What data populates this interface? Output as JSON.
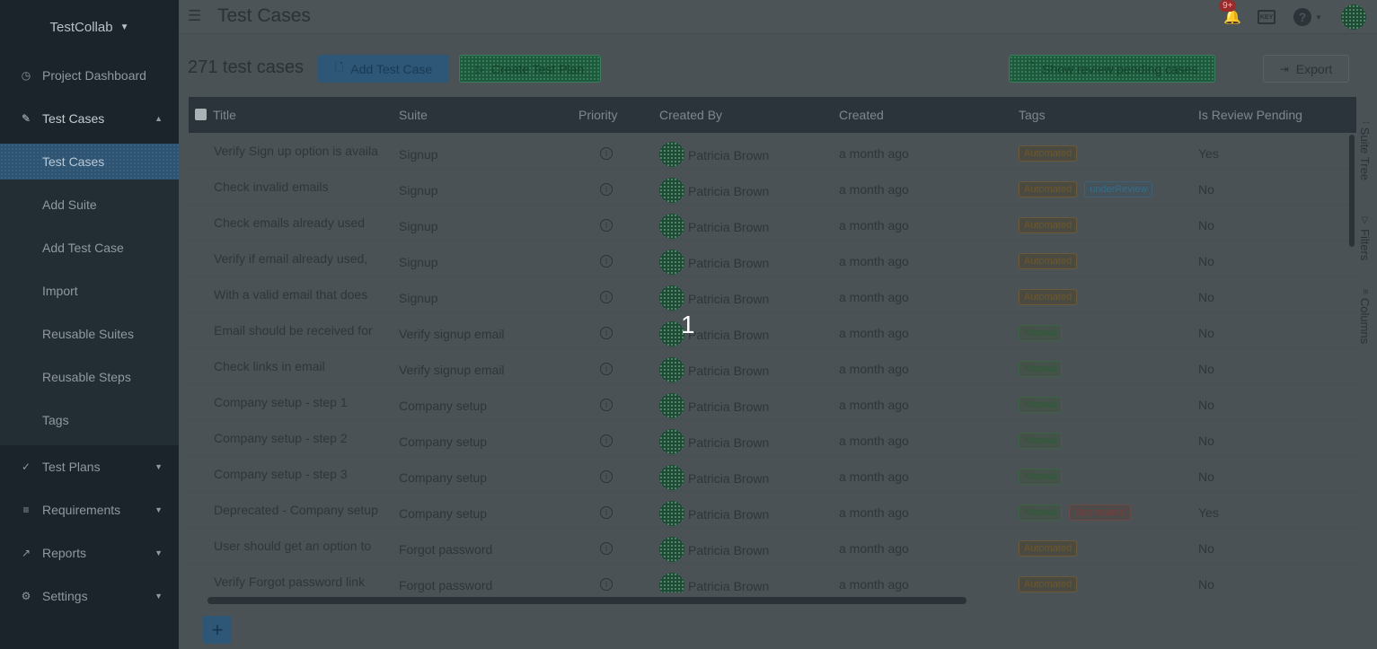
{
  "sidebar": {
    "brand": "TestCollab",
    "items": [
      {
        "label": "Project Dashboard",
        "icon": "clock-icon"
      },
      {
        "label": "Test Cases",
        "icon": "edit-icon"
      },
      {
        "label": "Test Plans",
        "icon": "check-circle-icon"
      },
      {
        "label": "Requirements",
        "icon": "list-icon"
      },
      {
        "label": "Reports",
        "icon": "chart-icon"
      },
      {
        "label": "Settings",
        "icon": "gear-icon"
      }
    ],
    "sub_items": [
      "Test Cases",
      "Add Suite",
      "Add Test Case",
      "Import",
      "Reusable Suites",
      "Reusable Steps",
      "Tags"
    ]
  },
  "header": {
    "title": "Test Cases",
    "notification_count": "9+",
    "keyboard_icon_text": "KEY"
  },
  "toolbar": {
    "count_text": "271 test cases",
    "add_label": "Add Test Case",
    "plan_label": "Create Test Plan",
    "review_label": "Show review pending cases",
    "export_label": "Export"
  },
  "table": {
    "columns": [
      "Title",
      "Suite",
      "Priority",
      "Created By",
      "Created",
      "Tags",
      "Is Review Pending"
    ],
    "rows": [
      {
        "title": "Verify Sign up option is available",
        "suite": "Signup",
        "created_by": "Patricia Brown",
        "created": "a month ago",
        "tags": [
          {
            "label": "Automated",
            "kind": "automated"
          }
        ],
        "pending": "Yes"
      },
      {
        "title": "Check invalid emails",
        "suite": "Signup",
        "created_by": "Patricia Brown",
        "created": "a month ago",
        "tags": [
          {
            "label": "Automated",
            "kind": "automated"
          },
          {
            "label": "underReview",
            "kind": "review"
          }
        ],
        "pending": "No"
      },
      {
        "title": "Check emails already used",
        "suite": "Signup",
        "created_by": "Patricia Brown",
        "created": "a month ago",
        "tags": [
          {
            "label": "Automated",
            "kind": "automated"
          }
        ],
        "pending": "No"
      },
      {
        "title": "Verify if email already used, ",
        "suite": "Signup",
        "created_by": "Patricia Brown",
        "created": "a month ago",
        "tags": [
          {
            "label": "Automated",
            "kind": "automated"
          }
        ],
        "pending": "No"
      },
      {
        "title": "With a valid email that does",
        "suite": "Signup",
        "created_by": "Patricia Brown",
        "created": "a month ago",
        "tags": [
          {
            "label": "Automated",
            "kind": "automated"
          }
        ],
        "pending": "No"
      },
      {
        "title": "Email should be received for",
        "suite": "Verify signup email",
        "created_by": "Patricia Brown",
        "created": "a month ago",
        "tags": [
          {
            "label": "Manual",
            "kind": "manual"
          }
        ],
        "pending": "No"
      },
      {
        "title": "Check links in email",
        "suite": "Verify signup email",
        "created_by": "Patricia Brown",
        "created": "a month ago",
        "tags": [
          {
            "label": "Manual",
            "kind": "manual"
          }
        ],
        "pending": "No"
      },
      {
        "title": "Company setup - step 1",
        "suite": "Company setup",
        "created_by": "Patricia Brown",
        "created": "a month ago",
        "tags": [
          {
            "label": "Manual",
            "kind": "manual"
          }
        ],
        "pending": "No"
      },
      {
        "title": "Company setup - step 2",
        "suite": "Company setup",
        "created_by": "Patricia Brown",
        "created": "a month ago",
        "tags": [
          {
            "label": "Manual",
            "kind": "manual"
          }
        ],
        "pending": "No"
      },
      {
        "title": "Company setup - step 3",
        "suite": "Company setup",
        "created_by": "Patricia Brown",
        "created": "a month ago",
        "tags": [
          {
            "label": "Manual",
            "kind": "manual"
          }
        ],
        "pending": "No"
      },
      {
        "title": "Deprecated - Company setup",
        "suite": "Company setup",
        "created_by": "Patricia Brown",
        "created": "a month ago",
        "tags": [
          {
            "label": "Manual",
            "kind": "manual"
          },
          {
            "label": "Deprecated",
            "kind": "deprecated"
          }
        ],
        "pending": "Yes"
      },
      {
        "title": "User should get an option to",
        "suite": "Forgot password",
        "created_by": "Patricia Brown",
        "created": "a month ago",
        "tags": [
          {
            "label": "Automated",
            "kind": "automated"
          }
        ],
        "pending": "No"
      },
      {
        "title": "Verify Forgot password link",
        "suite": "Forgot password",
        "created_by": "Patricia Brown",
        "created": "a month ago",
        "tags": [
          {
            "label": "Automated",
            "kind": "automated"
          }
        ],
        "pending": "No"
      }
    ]
  },
  "side_panel": {
    "tabs": [
      "Suite Tree",
      "Filters",
      "Columns"
    ]
  },
  "fab_label": "+",
  "overlay_marker": "1",
  "colors": {
    "sidebar_bg": "#1b242b",
    "active_item": "#2e5473",
    "primary_button": "#2d5677",
    "green_button": "#1d5a3e"
  }
}
